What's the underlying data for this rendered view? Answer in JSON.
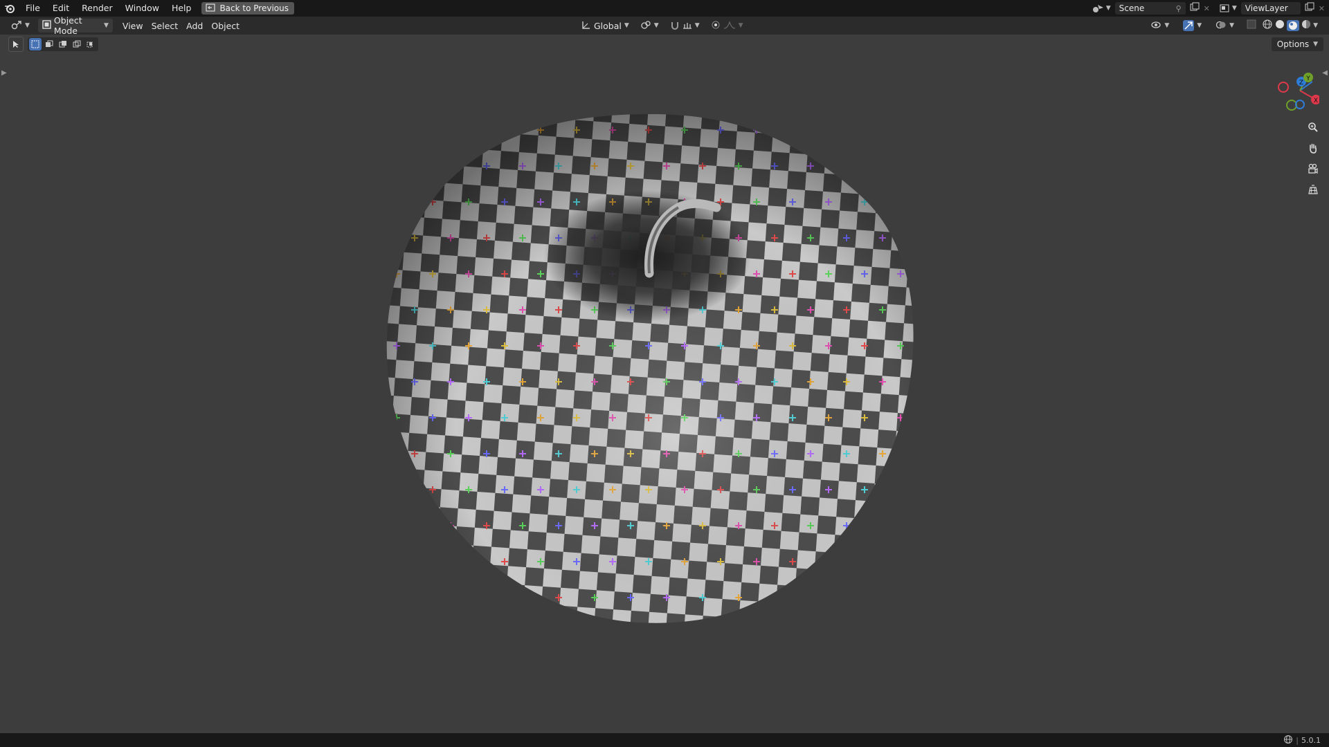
{
  "menu": {
    "items": [
      "File",
      "Edit",
      "Render",
      "Window",
      "Help"
    ],
    "back_label": "Back to Previous"
  },
  "scene": {
    "label": "Scene"
  },
  "view_layer": {
    "label": "ViewLayer"
  },
  "header": {
    "mode": "Object Mode",
    "menus": [
      "View",
      "Select",
      "Add",
      "Object"
    ],
    "transform_orientation": "Global"
  },
  "viewport": {
    "options_label": "Options",
    "gizmo": {
      "x": "X",
      "y": "Y",
      "z": "Z"
    },
    "object": "apple-mesh-checker-uv"
  },
  "status": {
    "version": "5.0.1"
  },
  "icons": [
    "blender-logo-icon",
    "back-icon",
    "editor-type-icon",
    "object-mode-icon",
    "global-transform-icon",
    "pivot-icon",
    "snap-icon",
    "proportional-icon",
    "select-tool-icon",
    "select-box-icon",
    "zoom-icon",
    "hand-icon",
    "camera-icon",
    "grid-icon",
    "overlay-icon",
    "xray-icon",
    "wireframe-shading-icon",
    "solid-shading-icon",
    "material-shading-icon",
    "rendered-shading-icon",
    "network-icon"
  ],
  "colors": {
    "accent": "#4772b3",
    "axis_x": "#e0384b",
    "axis_y": "#6ea02a",
    "axis_z": "#2e7cd6"
  }
}
